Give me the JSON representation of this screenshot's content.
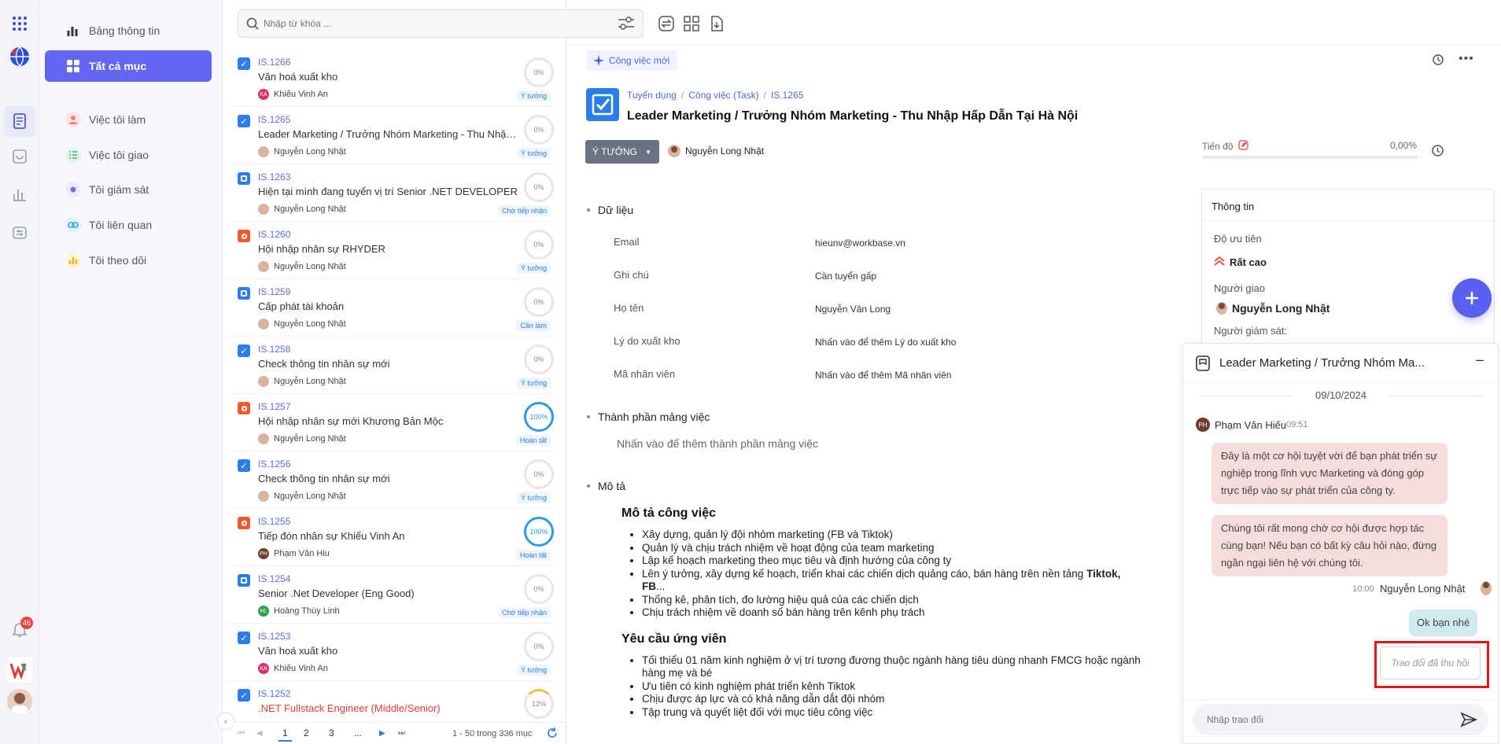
{
  "nav": {
    "items": [
      {
        "label": "Bảng thông tin"
      },
      {
        "label": "Tất cả mục"
      },
      {
        "label": "Việc tôi làm"
      },
      {
        "label": "Việc tôi giao"
      },
      {
        "label": "Tôi giám sát"
      },
      {
        "label": "Tôi liên quan"
      },
      {
        "label": "Tôi theo dõi"
      }
    ],
    "notification_count": "46"
  },
  "search": {
    "placeholder": "Nhập từ khóa ..."
  },
  "tasks": [
    {
      "code": "IS.1266",
      "title": "Văn hoá xuất kho",
      "assignee": "Khiếu Vinh An",
      "initials": "KA",
      "progress": "0%",
      "status": "Ý tưởng",
      "icon": "checkbox-icon"
    },
    {
      "code": "IS.1265",
      "title": "Leader Marketing / Trưởng Nhóm Marketing - Thu Nhập Hấp Dẫn Tại Hà Nội",
      "assignee": "Nguyễn Long Nhật",
      "initials": "",
      "progress": "0%",
      "status": "Ý tưởng",
      "icon": "checkbox-icon"
    },
    {
      "code": "IS.1263",
      "title": "Hiện tại mình đang tuyển vị trí Senior .NET DEVELOPER",
      "assignee": "Nguyễn Long Nhật",
      "initials": "",
      "progress": "0%",
      "status": "Chờ tiếp nhận",
      "icon": "subtask-icon"
    },
    {
      "code": "IS.1260",
      "title": "Hội nhập nhân sự RHYDER",
      "assignee": "Nguyễn Long Nhật",
      "initials": "",
      "progress": "0%",
      "status": "Ý tưởng",
      "icon": "record-icon"
    },
    {
      "code": "IS.1259",
      "title": "Cấp phát tài khoản",
      "assignee": "Nguyễn Long Nhật",
      "initials": "",
      "progress": "0%",
      "status": "Cần làm",
      "icon": "subtask-icon"
    },
    {
      "code": "IS.1258",
      "title": "Check thông tin nhân sự mới",
      "assignee": "Nguyễn Long Nhật",
      "initials": "",
      "progress": "0%",
      "status": "Ý tưởng",
      "icon": "checkbox-icon"
    },
    {
      "code": "IS.1257",
      "title": "Hội nhập nhân sự mới Khương Bản Mộc",
      "assignee": "Nguyễn Long Nhật",
      "initials": "",
      "progress": "100%",
      "status": "Hoàn tất",
      "icon": "record-icon"
    },
    {
      "code": "IS.1256",
      "title": "Check thông tin nhân sự mới",
      "assignee": "Nguyễn Long Nhật",
      "initials": "",
      "progress": "0%",
      "status": "Ý tưởng",
      "icon": "checkbox-icon"
    },
    {
      "code": "IS.1255",
      "title": "Tiếp đón nhân sự Khiếu Vinh An",
      "assignee": "Phạm Văn Hiu",
      "initials": "PH",
      "progress": "100%",
      "status": "Hoàn tất",
      "icon": "record-icon"
    },
    {
      "code": "IS.1254",
      "title": "Senior .Net Developer (Eng Good)",
      "assignee": "Hoàng Thùy Linh",
      "initials": "HL",
      "progress": "0%",
      "status": "Chờ tiếp nhận",
      "icon": "subtask-icon"
    },
    {
      "code": "IS.1253",
      "title": "Văn hoá xuất kho",
      "assignee": "Khiếu Vinh An",
      "initials": "KA",
      "progress": "0%",
      "status": "Ý tưởng",
      "icon": "checkbox-icon"
    },
    {
      "code": "IS.1252",
      "title": ".NET Fullstack Engineer (Middle/Senior)",
      "assignee": "",
      "initials": "",
      "progress": "12%",
      "status": "",
      "icon": "checkbox-icon"
    }
  ],
  "pagination": {
    "pages": [
      "1",
      "2",
      "3",
      "..."
    ],
    "summary": "1 - 50 trong 336 mục"
  },
  "detail": {
    "new_task": "Công việc mới",
    "breadcrumb": [
      "Tuyển dụng",
      "Công việc (Task)",
      "IS.1265"
    ],
    "title": "Leader Marketing / Trưởng Nhóm Marketing - Thu Nhập Hấp Dẫn Tại Hà Nội",
    "status": "Ý TƯỞNG",
    "owner": "Nguyễn Long Nhật",
    "progress_label": "Tiến độ",
    "progress_value": "0,00%",
    "progress_fraction": 0,
    "data_section": "Dữ liệu",
    "fields": [
      {
        "label": "Email",
        "value": "hieunv@workbase.vn"
      },
      {
        "label": "Ghi chú",
        "value": "Cần tuyển gấp"
      },
      {
        "label": "Họ tên",
        "value": "Nguyễn Văn Long"
      },
      {
        "label": "Lý do xuất kho",
        "value": "Nhấn vào để thêm Lý do xuất kho"
      },
      {
        "label": "Mã nhân viên",
        "value": "Nhấn vào để thêm Mã nhân viên"
      }
    ],
    "components_section": "Thành phần mảng việc",
    "components_placeholder": "Nhấn vào để thêm thành phần mảng việc",
    "desc_section": "Mô tả",
    "desc_heading1": "Mô tả công việc",
    "desc_items1": [
      "Xây dựng, quản lý đội nhóm marketing (FB và Tiktok)",
      "Quản lý và chịu trách nhiệm về hoạt động của team marketing",
      "Lập kế hoạch marketing theo mục tiêu và định hướng của công ty"
    ],
    "desc_item4_a": "Lên ý tưởng, xây dựng kế hoạch, triển khai các chiến dịch quảng cáo, bán hàng trên nền tảng",
    "desc_item4_b": "Tiktok,",
    "desc_item4_c": "FB",
    "desc_item4_d": "...",
    "desc_items1b": [
      "Thống kê, phân tích, đo lường hiệu quả của các chiến dịch",
      "Chịu trách nhiệm về doanh số bán hàng trên kênh phụ trách"
    ],
    "desc_heading2": "Yêu cầu ứng viên",
    "desc_items2": [
      "Tối thiểu 01 năm kinh nghiệm ở vị trí tương đương thuộc ngành hàng tiêu dùng nhanh FMCG hoặc ngành hàng mẹ và bé",
      "Ưu tiên có kinh nghiệm phát triển kênh Tiktok",
      "Chịu được áp lực và có khả năng dẫn dắt đội nhóm",
      "Tập trung và quyết liệt đối với mục tiêu công việc"
    ]
  },
  "info": {
    "title": "Thông tin",
    "priority_label": "Độ ưu tiên",
    "priority_value": "Rất cao",
    "assigner_label": "Người giao",
    "assigner_value": "Nguyễn Long Nhật",
    "supervisor_label": "Người giám sát:"
  },
  "chat": {
    "title": "Leader Marketing / Trưởng Nhóm Ma...",
    "date": "09/10/2024",
    "sender1": "Phạm Văn Hiếu",
    "sender1_initials": "PH",
    "time1": "09:51",
    "msg1": "Đây là một cơ hội tuyệt vời để bạn phát triển sự nghiệp trong lĩnh vực Marketing và đóng góp trực tiếp vào sự phát triển của công ty.",
    "msg2": "Chúng tôi rất mong chờ cơ hội được hợp tác cùng bạn! Nếu bạn có bất kỳ câu hỏi nào, đừng ngần ngại liên hệ với chúng tôi.",
    "time2": "10:00",
    "sender2": "Nguyễn Long Nhật",
    "msg3": "Ok bạn nhé",
    "recalled": "Trao đổi đã thu hồi",
    "input_placeholder": "Nhập trao đổi"
  }
}
